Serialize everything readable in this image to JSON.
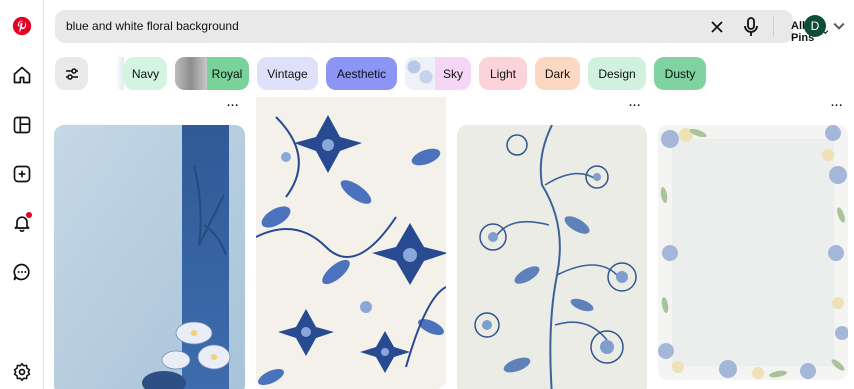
{
  "app": {
    "brand": "Pinterest"
  },
  "search": {
    "query": "blue and white floral background",
    "scope_label": "All Pins"
  },
  "account": {
    "initial": "D"
  },
  "colors": {
    "brand": "#e60023",
    "avatar": "#0f4d37",
    "search_bg": "#e9e9e9"
  },
  "nav": [
    {
      "name": "home-icon"
    },
    {
      "name": "explore-icon"
    },
    {
      "name": "create-icon"
    },
    {
      "name": "notifications-icon",
      "has_badge": true
    },
    {
      "name": "messages-icon"
    },
    {
      "name": "settings-icon"
    }
  ],
  "chips": [
    {
      "label": "Navy",
      "bg": "#d3f4e1"
    },
    {
      "label": "Royal",
      "bg": "#7ad29b"
    },
    {
      "label": "Vintage",
      "bg": "#dfe1fb"
    },
    {
      "label": "Aesthetic",
      "bg": "#8c94f4"
    },
    {
      "label": "Sky",
      "bg": "#f6d6f6"
    },
    {
      "label": "Light",
      "bg": "#fbd3d9"
    },
    {
      "label": "Dark",
      "bg": "#fcd8c2"
    },
    {
      "label": "Design",
      "bg": "#cff1de"
    },
    {
      "label": "Dusty",
      "bg": "#80d3a0"
    }
  ],
  "pins": [
    {
      "alt": "blue watercolor background with floral border"
    },
    {
      "alt": "blue and white chinoiserie floral pattern"
    },
    {
      "alt": "blue floral vine pattern on cream background"
    },
    {
      "alt": "floral frame with blue and white roses"
    }
  ],
  "more_label": "..."
}
